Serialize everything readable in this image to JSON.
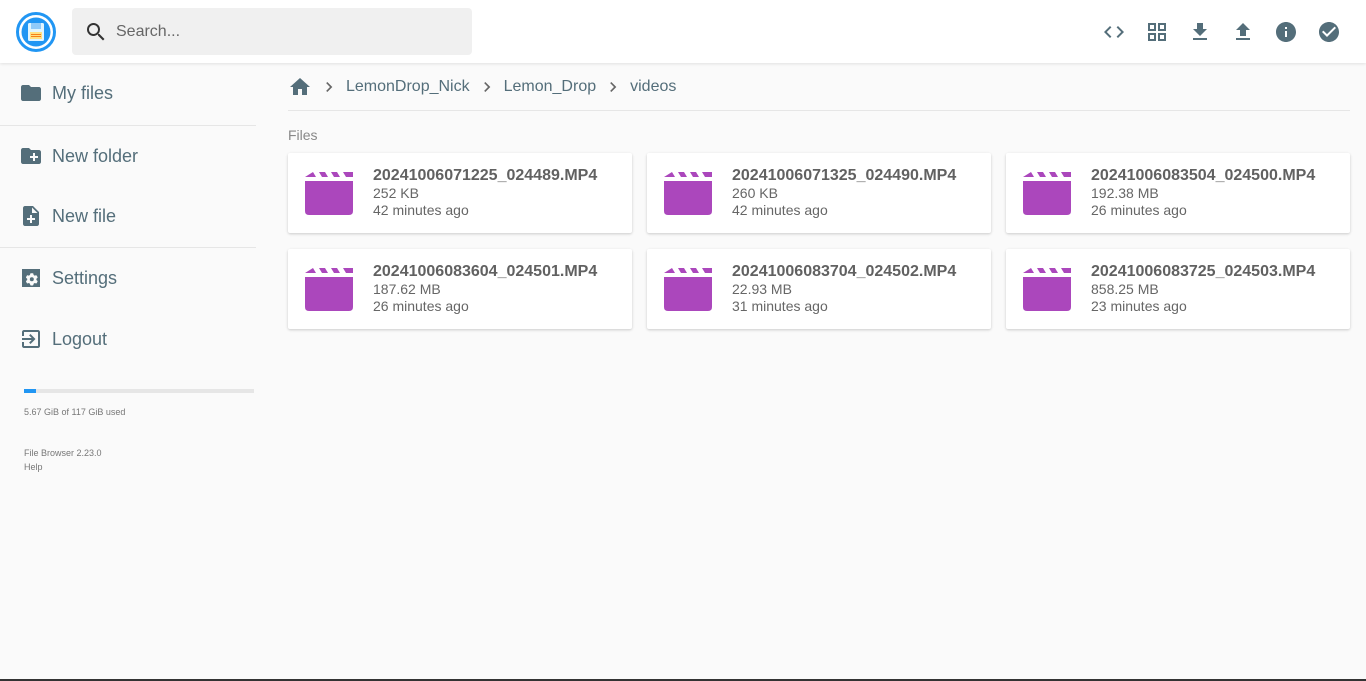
{
  "header": {
    "search_placeholder": "Search...",
    "actions": [
      "code-icon",
      "grid-view-icon",
      "download-icon",
      "upload-icon",
      "info-icon",
      "check-circle-icon"
    ]
  },
  "sidebar": {
    "items": [
      {
        "label": "My files",
        "icon": "folder-icon"
      },
      {
        "label": "New folder",
        "icon": "new-folder-icon"
      },
      {
        "label": "New file",
        "icon": "new-file-icon"
      },
      {
        "label": "Settings",
        "icon": "settings-icon"
      },
      {
        "label": "Logout",
        "icon": "logout-icon"
      }
    ],
    "quota": {
      "text": "5.67 GiB of 117 GiB used",
      "fraction": 0.05
    },
    "credits": {
      "version": "File Browser 2.23.0",
      "help": "Help"
    }
  },
  "breadcrumbs": [
    "LemonDrop_Nick",
    "Lemon_Drop",
    "videos"
  ],
  "section_title": "Files",
  "files": [
    {
      "name": "20241006071225_024489.MP4",
      "size": "252 KB",
      "modified": "42 minutes ago"
    },
    {
      "name": "20241006071325_024490.MP4",
      "size": "260 KB",
      "modified": "42 minutes ago"
    },
    {
      "name": "20241006083504_024500.MP4",
      "size": "192.38 MB",
      "modified": "26 minutes ago"
    },
    {
      "name": "20241006083604_024501.MP4",
      "size": "187.62 MB",
      "modified": "26 minutes ago"
    },
    {
      "name": "20241006083704_024502.MP4",
      "size": "22.93 MB",
      "modified": "31 minutes ago"
    },
    {
      "name": "20241006083725_024503.MP4",
      "size": "858.25 MB",
      "modified": "23 minutes ago"
    }
  ],
  "colors": {
    "accent": "#2196f3",
    "video_icon": "#ab47bc",
    "text": "#546e7a"
  }
}
